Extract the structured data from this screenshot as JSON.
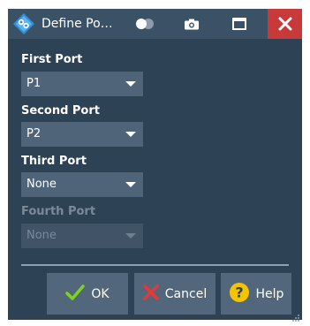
{
  "window": {
    "title": "Define Po…"
  },
  "titlebar": {
    "toggle_icon": "toggle-icon",
    "camera_icon": "camera-icon",
    "maximize_icon": "maximize-icon",
    "close_icon": "close-icon"
  },
  "fields": [
    {
      "label": "First Port",
      "value": "P1",
      "enabled": true
    },
    {
      "label": "Second Port",
      "value": "P2",
      "enabled": true
    },
    {
      "label": "Third Port",
      "value": "None",
      "enabled": true
    },
    {
      "label": "Fourth Port",
      "value": "None",
      "enabled": false
    }
  ],
  "buttons": {
    "ok": "OK",
    "cancel": "Cancel",
    "help": "Help"
  },
  "colors": {
    "background": "#2e4256",
    "titlebar": "#3a5166",
    "close": "#c8393a",
    "ok_check": "#7ed321",
    "cancel_x": "#e53935",
    "help_badge": "#f5c400"
  }
}
